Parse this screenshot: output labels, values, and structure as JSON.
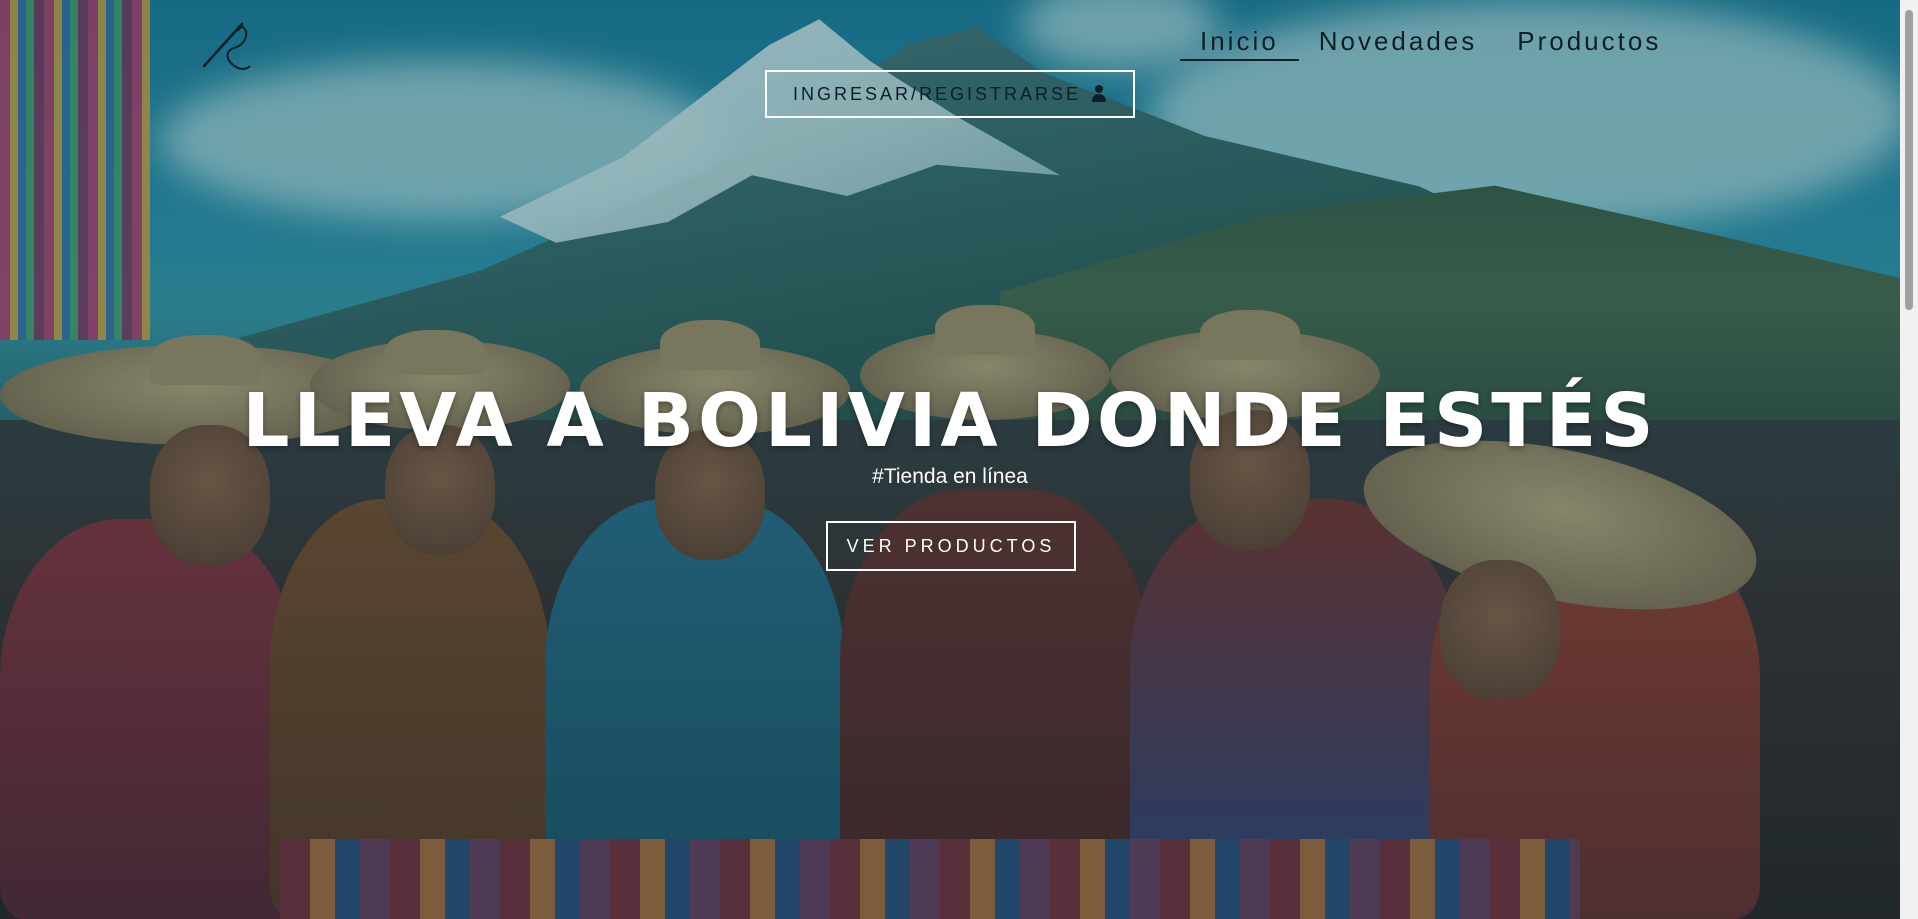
{
  "header": {
    "logo_icon": "needle-thread-icon",
    "nav": [
      {
        "label": "Inicio",
        "active": true
      },
      {
        "label": "Novedades",
        "active": false
      },
      {
        "label": "Productos",
        "active": false
      }
    ],
    "login_label": "INGRESAR/REGISTRARSE",
    "login_icon": "user-icon"
  },
  "hero": {
    "title": "LLEVA A BOLIVIA DONDE ESTÉS",
    "subtitle": "#Tienda en línea",
    "cta_label": "VER PRODUCTOS"
  },
  "colors": {
    "nav_text": "#0e1e26",
    "hero_text": "#ffffff",
    "button_border": "#ffffff"
  }
}
